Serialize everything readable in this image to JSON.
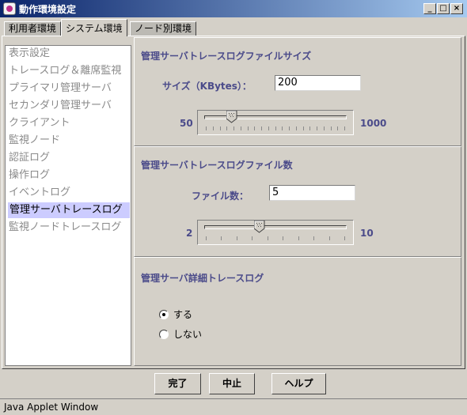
{
  "window": {
    "title": "動作環境設定",
    "icon": "applet-icon",
    "controls": {
      "minimize": "_",
      "maximize": "□",
      "close": "×"
    }
  },
  "tabs": [
    {
      "label": "利用者環境",
      "active": false
    },
    {
      "label": "システム環境",
      "active": true
    },
    {
      "label": "ノード別環境",
      "active": false
    }
  ],
  "sidebar": {
    "items": [
      {
        "label": "表示設定",
        "selected": false
      },
      {
        "label": "トレースログ＆離席監視",
        "selected": false
      },
      {
        "label": "プライマリ管理サーバ",
        "selected": false
      },
      {
        "label": "セカンダリ管理サーバ",
        "selected": false
      },
      {
        "label": "クライアント",
        "selected": false
      },
      {
        "label": "監視ノード",
        "selected": false
      },
      {
        "label": "認証ログ",
        "selected": false
      },
      {
        "label": "操作ログ",
        "selected": false
      },
      {
        "label": "イベントログ",
        "selected": false
      },
      {
        "label": "管理サーバトレースログ",
        "selected": true
      },
      {
        "label": "監視ノードトレースログ",
        "selected": false
      }
    ]
  },
  "filesize_panel": {
    "title": "管理サーバトレースログファイルサイズ",
    "size_label": "サイズ（KBytes）：",
    "size_value": "200",
    "slider_min": "50",
    "slider_max": "1000",
    "slider_value_fraction": 0.16
  },
  "filecount_panel": {
    "title": "管理サーバトレースログファイル数",
    "count_label": "ファイル数：",
    "count_value": "5",
    "slider_min": "2",
    "slider_max": "10",
    "slider_value_fraction": 0.375
  },
  "detail_panel": {
    "title": "管理サーバ詳細トレースログ",
    "options": [
      {
        "label": "する",
        "checked": true
      },
      {
        "label": "しない",
        "checked": false
      }
    ]
  },
  "buttons": {
    "ok": "完了",
    "cancel": "中止",
    "help": "ヘルプ"
  },
  "status_bar": {
    "text": "Java Applet Window"
  },
  "colors": {
    "label_text": "#4b4b8a",
    "selection": "#ccccff",
    "disabled_text": "#8a8a8a",
    "titlebar": "#0a246a"
  }
}
